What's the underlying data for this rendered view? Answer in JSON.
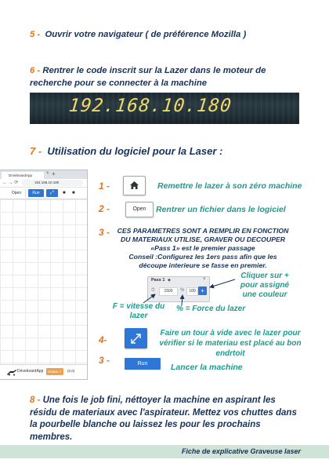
{
  "steps": {
    "s5": {
      "num": "5 -",
      "text": "Ouvrir votre navigateur ( de préférence Mozilla )"
    },
    "s6": {
      "num": "6 -",
      "text": "Rentrer le code inscrit sur la Lazer dans le moteur de recherche pour se connecter à la machine"
    },
    "ip_photo_text": "192.168.10.180",
    "s7": {
      "num": "7 -",
      "text": "Utilisation du logiciel pour la Laser :"
    },
    "s8": {
      "num": "8 -",
      "text": "Une fois le job fini, néttoyer la machine en aspirant les résidu de materiaux avec l'aspirateur. Mettez vos chuttes dans la pourbelle blanche ou laissez les pour les prochains membres."
    }
  },
  "browser": {
    "tab_title": "DriveboardApp",
    "tab_close": "×",
    "new_tab": "+",
    "nav": "← → ⟳",
    "url": "192.168.10.180",
    "open_label": "Open",
    "run_label": "Run",
    "frame_glyph": "⤢",
    "stop_glyph": "■",
    "pause_glyph": "■",
    "app_name": "DriveboardApp",
    "status_label": "Status ✓",
    "position": "(0,0)"
  },
  "instructions": {
    "home": {
      "num": "1 -",
      "desc": "Remettre le lazer à son zéro machine"
    },
    "open": {
      "num": "2 -",
      "button": "Open",
      "desc": "Rentrer un fichier dans le logiciel"
    },
    "params": {
      "num": "3 -",
      "lines": [
        "CES PARAMETRES SONT A REMPLIR EN FONCTION",
        "DU MATERIAUX UTILISE, GRAVER OU DECOUPER",
        "«Pass 1» est le premier passage",
        "Conseil :Configurez les 1ers pass afin que les",
        "découpe interieure se fasse en premier."
      ]
    },
    "pass_panel": {
      "label": "Pass 1",
      "arrow": "◆",
      "close": "×",
      "speed_icon": "⏱",
      "speed": "1500",
      "power_icon": "%",
      "power": "100",
      "add": "+"
    },
    "click_desc": "Cliquer sur + pour assigné une couleur",
    "speed_desc": "F = vitesse du lazer",
    "power_desc": "% = Force du lazer",
    "frame": {
      "num": "4-",
      "desc": "Faire un tour à vide avec le lazer pour vérifier si le materiau est placé au bon endrtoit"
    },
    "run": {
      "num": "3 -",
      "button": "Run",
      "desc": "Lancer la machine"
    }
  },
  "footer": {
    "text": "Fiche de explicative Graveuse laser"
  },
  "colors": {
    "orange": "#e0761c",
    "navy": "#16325c",
    "green": "#1f9a8c",
    "blue": "#2f77d6",
    "band": "#cfe3d8"
  }
}
